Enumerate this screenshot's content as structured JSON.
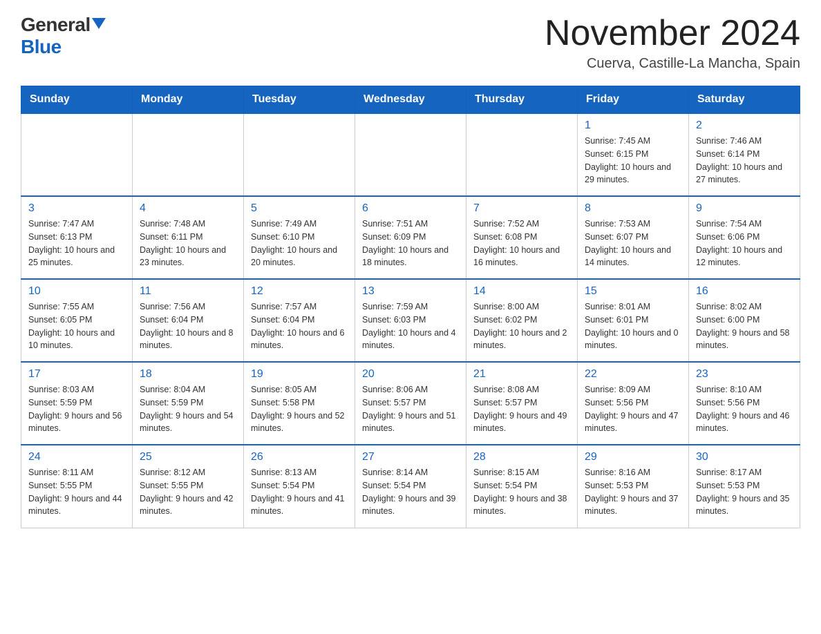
{
  "header": {
    "logo_general": "General",
    "logo_blue": "Blue",
    "month_title": "November 2024",
    "location": "Cuerva, Castille-La Mancha, Spain"
  },
  "days_of_week": [
    "Sunday",
    "Monday",
    "Tuesday",
    "Wednesday",
    "Thursday",
    "Friday",
    "Saturday"
  ],
  "weeks": [
    {
      "days": [
        {
          "num": "",
          "info": ""
        },
        {
          "num": "",
          "info": ""
        },
        {
          "num": "",
          "info": ""
        },
        {
          "num": "",
          "info": ""
        },
        {
          "num": "",
          "info": ""
        },
        {
          "num": "1",
          "info": "Sunrise: 7:45 AM\nSunset: 6:15 PM\nDaylight: 10 hours and 29 minutes."
        },
        {
          "num": "2",
          "info": "Sunrise: 7:46 AM\nSunset: 6:14 PM\nDaylight: 10 hours and 27 minutes."
        }
      ]
    },
    {
      "days": [
        {
          "num": "3",
          "info": "Sunrise: 7:47 AM\nSunset: 6:13 PM\nDaylight: 10 hours and 25 minutes."
        },
        {
          "num": "4",
          "info": "Sunrise: 7:48 AM\nSunset: 6:11 PM\nDaylight: 10 hours and 23 minutes."
        },
        {
          "num": "5",
          "info": "Sunrise: 7:49 AM\nSunset: 6:10 PM\nDaylight: 10 hours and 20 minutes."
        },
        {
          "num": "6",
          "info": "Sunrise: 7:51 AM\nSunset: 6:09 PM\nDaylight: 10 hours and 18 minutes."
        },
        {
          "num": "7",
          "info": "Sunrise: 7:52 AM\nSunset: 6:08 PM\nDaylight: 10 hours and 16 minutes."
        },
        {
          "num": "8",
          "info": "Sunrise: 7:53 AM\nSunset: 6:07 PM\nDaylight: 10 hours and 14 minutes."
        },
        {
          "num": "9",
          "info": "Sunrise: 7:54 AM\nSunset: 6:06 PM\nDaylight: 10 hours and 12 minutes."
        }
      ]
    },
    {
      "days": [
        {
          "num": "10",
          "info": "Sunrise: 7:55 AM\nSunset: 6:05 PM\nDaylight: 10 hours and 10 minutes."
        },
        {
          "num": "11",
          "info": "Sunrise: 7:56 AM\nSunset: 6:04 PM\nDaylight: 10 hours and 8 minutes."
        },
        {
          "num": "12",
          "info": "Sunrise: 7:57 AM\nSunset: 6:04 PM\nDaylight: 10 hours and 6 minutes."
        },
        {
          "num": "13",
          "info": "Sunrise: 7:59 AM\nSunset: 6:03 PM\nDaylight: 10 hours and 4 minutes."
        },
        {
          "num": "14",
          "info": "Sunrise: 8:00 AM\nSunset: 6:02 PM\nDaylight: 10 hours and 2 minutes."
        },
        {
          "num": "15",
          "info": "Sunrise: 8:01 AM\nSunset: 6:01 PM\nDaylight: 10 hours and 0 minutes."
        },
        {
          "num": "16",
          "info": "Sunrise: 8:02 AM\nSunset: 6:00 PM\nDaylight: 9 hours and 58 minutes."
        }
      ]
    },
    {
      "days": [
        {
          "num": "17",
          "info": "Sunrise: 8:03 AM\nSunset: 5:59 PM\nDaylight: 9 hours and 56 minutes."
        },
        {
          "num": "18",
          "info": "Sunrise: 8:04 AM\nSunset: 5:59 PM\nDaylight: 9 hours and 54 minutes."
        },
        {
          "num": "19",
          "info": "Sunrise: 8:05 AM\nSunset: 5:58 PM\nDaylight: 9 hours and 52 minutes."
        },
        {
          "num": "20",
          "info": "Sunrise: 8:06 AM\nSunset: 5:57 PM\nDaylight: 9 hours and 51 minutes."
        },
        {
          "num": "21",
          "info": "Sunrise: 8:08 AM\nSunset: 5:57 PM\nDaylight: 9 hours and 49 minutes."
        },
        {
          "num": "22",
          "info": "Sunrise: 8:09 AM\nSunset: 5:56 PM\nDaylight: 9 hours and 47 minutes."
        },
        {
          "num": "23",
          "info": "Sunrise: 8:10 AM\nSunset: 5:56 PM\nDaylight: 9 hours and 46 minutes."
        }
      ]
    },
    {
      "days": [
        {
          "num": "24",
          "info": "Sunrise: 8:11 AM\nSunset: 5:55 PM\nDaylight: 9 hours and 44 minutes."
        },
        {
          "num": "25",
          "info": "Sunrise: 8:12 AM\nSunset: 5:55 PM\nDaylight: 9 hours and 42 minutes."
        },
        {
          "num": "26",
          "info": "Sunrise: 8:13 AM\nSunset: 5:54 PM\nDaylight: 9 hours and 41 minutes."
        },
        {
          "num": "27",
          "info": "Sunrise: 8:14 AM\nSunset: 5:54 PM\nDaylight: 9 hours and 39 minutes."
        },
        {
          "num": "28",
          "info": "Sunrise: 8:15 AM\nSunset: 5:54 PM\nDaylight: 9 hours and 38 minutes."
        },
        {
          "num": "29",
          "info": "Sunrise: 8:16 AM\nSunset: 5:53 PM\nDaylight: 9 hours and 37 minutes."
        },
        {
          "num": "30",
          "info": "Sunrise: 8:17 AM\nSunset: 5:53 PM\nDaylight: 9 hours and 35 minutes."
        }
      ]
    }
  ]
}
